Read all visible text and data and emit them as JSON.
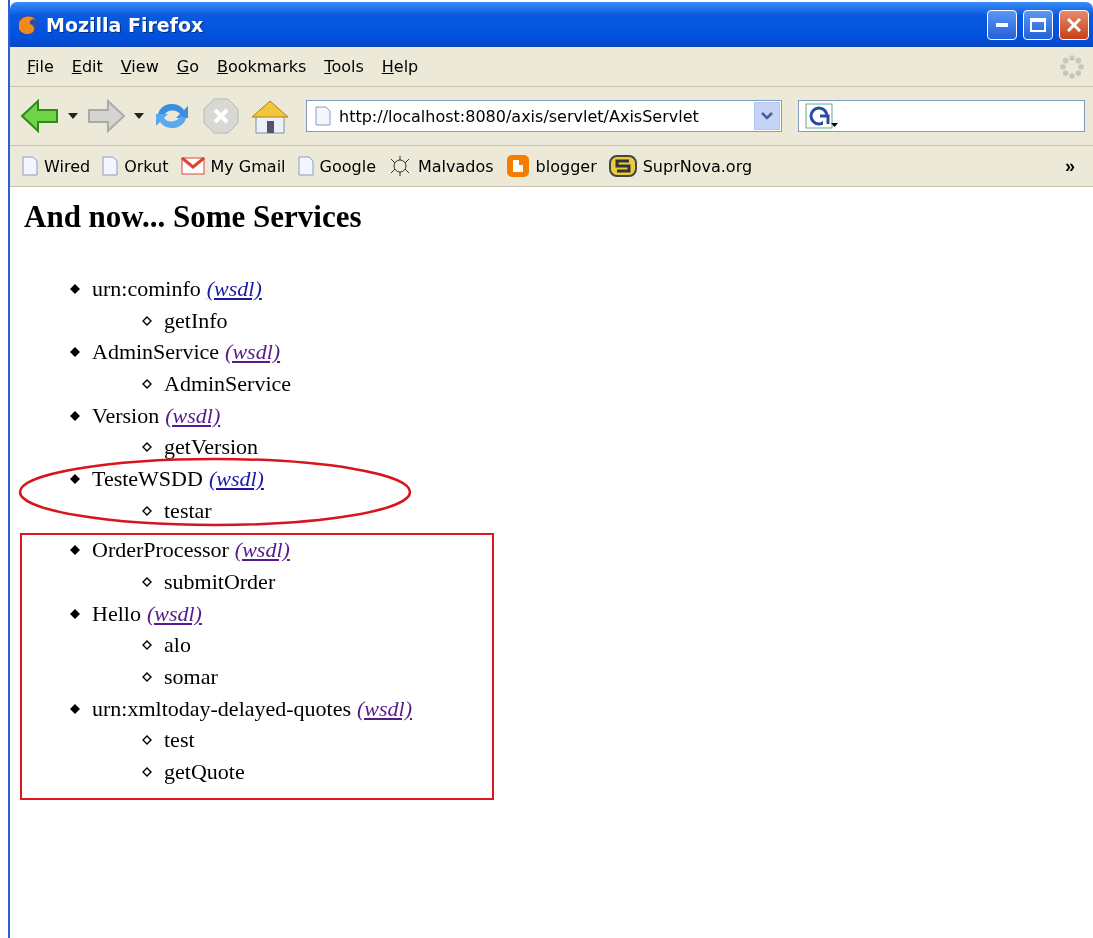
{
  "window": {
    "title": "Mozilla Firefox"
  },
  "menu": [
    {
      "label": "File"
    },
    {
      "label": "Edit"
    },
    {
      "label": "View"
    },
    {
      "label": "Go"
    },
    {
      "label": "Bookmarks"
    },
    {
      "label": "Tools"
    },
    {
      "label": "Help"
    }
  ],
  "toolbar": {
    "back_enabled": true,
    "forward_enabled": false,
    "stop_enabled": false,
    "url": "http://localhost:8080/axis/servlet/AxisServlet"
  },
  "bookmarks": [
    {
      "kind": "page",
      "label": "Wired"
    },
    {
      "kind": "page",
      "label": "Orkut"
    },
    {
      "kind": "gmail",
      "label": "My Gmail"
    },
    {
      "kind": "page",
      "label": "Google"
    },
    {
      "kind": "sketch",
      "label": "Malvados"
    },
    {
      "kind": "blogger",
      "label": "blogger"
    },
    {
      "kind": "suprnova",
      "label": "SuprNova.org"
    }
  ],
  "bookmarks_more": "»",
  "page": {
    "heading": "And now... Some Services",
    "groups": [
      {
        "kind": "plain",
        "services": [
          {
            "name": "urn:cominfo",
            "link": "(wsdl)",
            "visited": false,
            "operations": [
              "getInfo"
            ]
          },
          {
            "name": "AdminService",
            "link": "(wsdl)",
            "visited": true,
            "operations": [
              "AdminService"
            ]
          },
          {
            "name": "Version",
            "link": "(wsdl)",
            "visited": true,
            "operations": [
              "getVersion"
            ]
          }
        ]
      },
      {
        "kind": "ellipse",
        "services": [
          {
            "name": "TesteWSDD",
            "link": "(wsdl)",
            "visited": false,
            "operations": [
              "testar"
            ]
          }
        ]
      },
      {
        "kind": "box",
        "services": [
          {
            "name": "OrderProcessor",
            "link": "(wsdl)",
            "visited": true,
            "operations": [
              "submitOrder"
            ]
          },
          {
            "name": "Hello",
            "link": "(wsdl)",
            "visited": true,
            "operations": [
              "alo",
              "somar"
            ]
          },
          {
            "name": "urn:xmltoday-delayed-quotes",
            "link": "(wsdl)",
            "visited": true,
            "operations": [
              "test",
              "getQuote"
            ]
          }
        ]
      }
    ]
  }
}
